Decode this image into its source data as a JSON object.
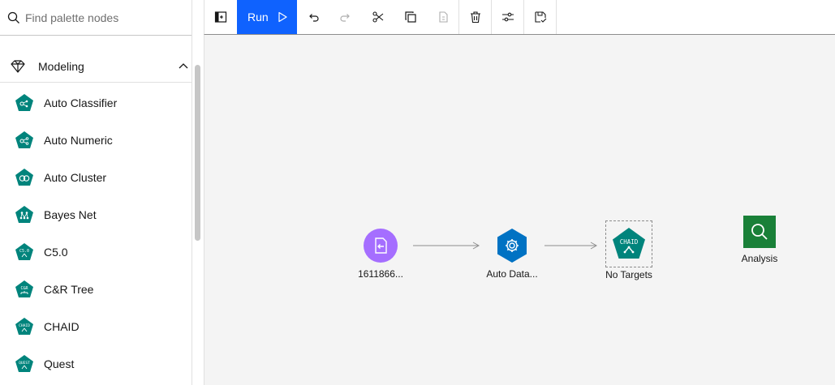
{
  "search": {
    "placeholder": "Find palette nodes"
  },
  "category": {
    "label": "Modeling"
  },
  "palette_items": [
    {
      "label": "Auto Classifier",
      "icon": "auto-classifier-icon"
    },
    {
      "label": "Auto Numeric",
      "icon": "auto-numeric-icon"
    },
    {
      "label": "Auto Cluster",
      "icon": "auto-cluster-icon"
    },
    {
      "label": "Bayes Net",
      "icon": "bayes-net-icon"
    },
    {
      "label": "C5.0",
      "icon": "c50-icon",
      "glyph": "C5.0"
    },
    {
      "label": "C&R Tree",
      "icon": "cr-tree-icon",
      "glyph": "C&R"
    },
    {
      "label": "CHAID",
      "icon": "chaid-icon",
      "glyph": "CHAID"
    },
    {
      "label": "Quest",
      "icon": "quest-icon",
      "glyph": "QUEST"
    }
  ],
  "toolbar": {
    "run_label": "Run"
  },
  "canvas": {
    "nodes": {
      "source": {
        "caption": "1611866..."
      },
      "auto_data": {
        "caption": "Auto Data..."
      },
      "chaid": {
        "caption": "No Targets",
        "glyph": "CHAID"
      },
      "analysis": {
        "caption": "Analysis"
      }
    }
  },
  "colors": {
    "teal": "#00847c",
    "run_blue": "#0f62fe",
    "source_purple": "#a56eff",
    "auto_data_blue": "#0072c3",
    "analysis_green": "#198038"
  }
}
